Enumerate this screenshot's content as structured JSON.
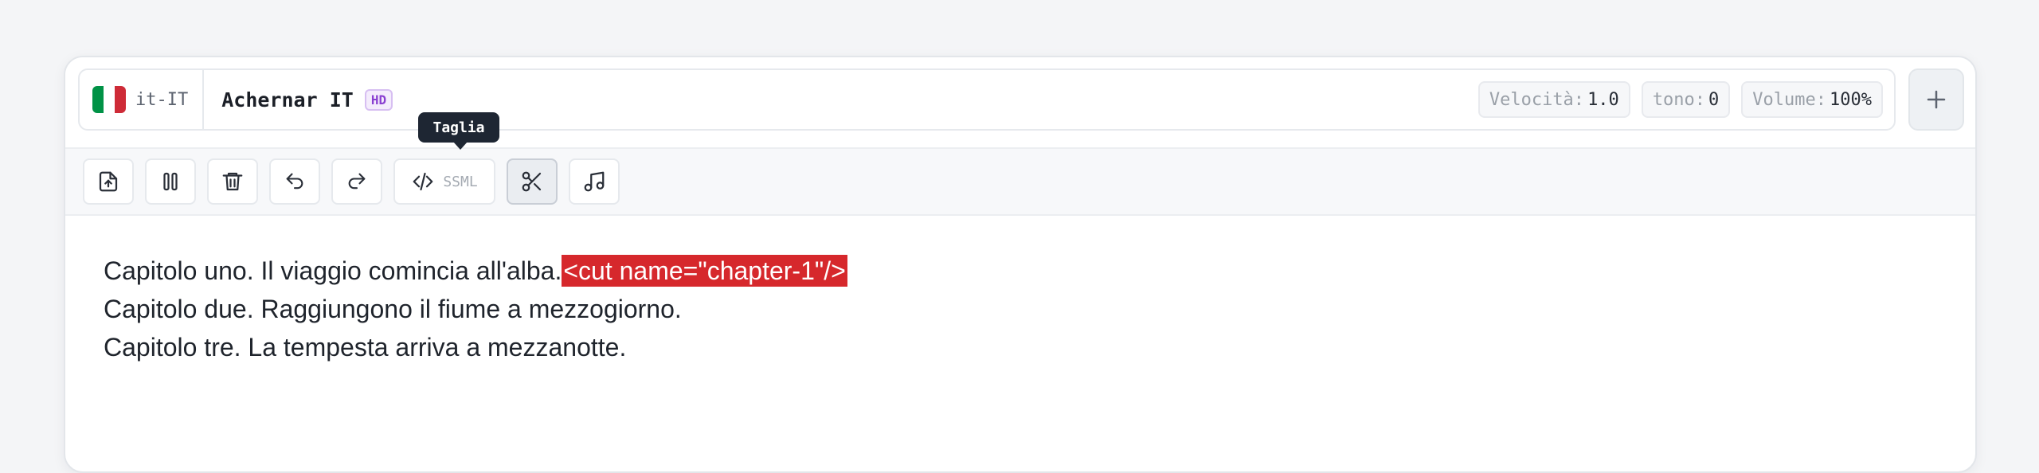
{
  "voice": {
    "lang_code": "it-IT",
    "flag_colors": [
      "#009246",
      "#ffffff",
      "#ce2b37"
    ],
    "name": "Achernar IT",
    "badge": "HD"
  },
  "params": [
    {
      "label": "Velocità:",
      "value": "1.0"
    },
    {
      "label": "tono:",
      "value": "0"
    },
    {
      "label": "Volume:",
      "value": "100%"
    }
  ],
  "toolbar": {
    "buttons": [
      {
        "icon": "file-upload-icon"
      },
      {
        "icon": "pause-icon"
      },
      {
        "icon": "trash-icon"
      },
      {
        "icon": "undo-icon"
      },
      {
        "icon": "redo-icon"
      },
      {
        "icon": "code-icon",
        "label": "SSML"
      },
      {
        "icon": "scissors-icon"
      },
      {
        "icon": "music-note-icon"
      }
    ],
    "tooltip": "Taglia"
  },
  "editor": {
    "lines": [
      {
        "text": "Capitolo uno. Il viaggio comincia all'alba.",
        "tag": "<cut name=\"chapter-1\"/>"
      },
      {
        "text": "Capitolo due. Raggiungono il fiume a mezzogiorno."
      },
      {
        "text": "Capitolo tre. La tempesta arriva a mezzanotte."
      }
    ],
    "highlight_color": "#d6282c"
  }
}
